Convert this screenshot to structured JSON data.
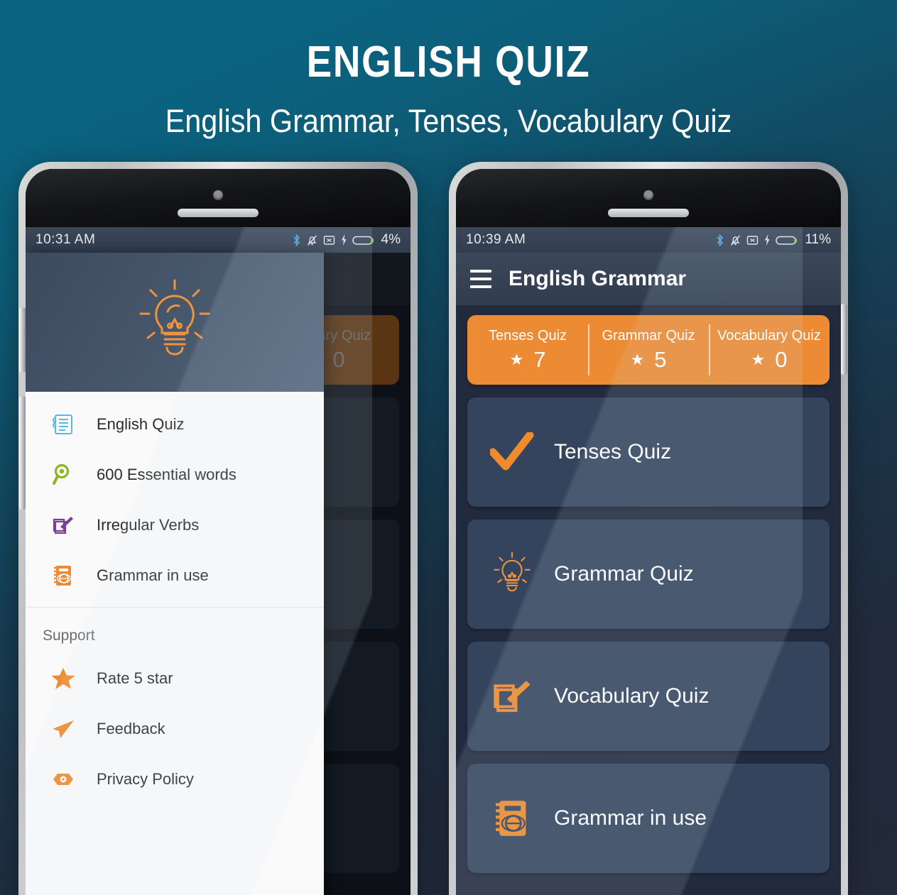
{
  "promo": {
    "title": "ENGLISH QUIZ",
    "subtitle": "English Grammar, Tenses, Vocabulary Quiz"
  },
  "colors": {
    "accent_orange": "#ec8b33",
    "card_blue": "#33445c",
    "screen_bg": "#222a3d",
    "drawer_bg": "#fafafa",
    "bg_teal": "#0a6380",
    "bg_navy": "#232a3a"
  },
  "left_phone": {
    "status": {
      "time": "10:31 AM",
      "battery_percent": "4%",
      "icons": [
        "bluetooth-icon",
        "mute-bell-icon",
        "alarm-off-icon",
        "charging-bolt-icon",
        "battery-icon"
      ]
    },
    "drawer": {
      "header_icon": "lightbulb-icon",
      "items": [
        {
          "label": "English Quiz",
          "icon": "notebook-icon",
          "color": "#5bb8e5"
        },
        {
          "label": "600 Essential words",
          "icon": "magnifier-icon",
          "color": "#8bb61e"
        },
        {
          "label": "Irregular Verbs",
          "icon": "book-pen-icon",
          "color": "#7b3f98"
        },
        {
          "label": "Grammar in use",
          "icon": "globe-book-icon",
          "color": "#ec8b33"
        }
      ],
      "section_label": "Support",
      "support_items": [
        {
          "label": "Rate 5 star",
          "icon": "star-icon",
          "color": "#ec8b33"
        },
        {
          "label": "Feedback",
          "icon": "paper-plane-icon",
          "color": "#ec8b33"
        },
        {
          "label": "Privacy Policy",
          "icon": "privacy-eye-icon",
          "color": "#ec8b33"
        }
      ]
    },
    "background_app": {
      "score_partial_label": "ulary Quiz",
      "score_partial_value": "0",
      "dim_card_count": 4
    }
  },
  "right_phone": {
    "status": {
      "time": "10:39 AM",
      "battery_percent": "11%",
      "icons": [
        "bluetooth-icon",
        "mute-bell-icon",
        "alarm-off-icon",
        "charging-bolt-icon",
        "battery-icon"
      ]
    },
    "appbar": {
      "menu_icon": "hamburger-icon",
      "title": "English Grammar"
    },
    "scores": [
      {
        "label": "Tenses Quiz",
        "star": "★",
        "value": "7"
      },
      {
        "label": "Grammar Quiz",
        "star": "★",
        "value": "5"
      },
      {
        "label": "Vocabulary Quiz",
        "star": "★",
        "value": "0"
      }
    ],
    "cards": [
      {
        "label": "Tenses Quiz",
        "icon": "check-mark-icon"
      },
      {
        "label": "Grammar Quiz",
        "icon": "lightbulb-icon"
      },
      {
        "label": "Vocabulary Quiz",
        "icon": "book-pen-icon"
      },
      {
        "label": "Grammar in use",
        "icon": "globe-book-icon"
      }
    ]
  }
}
